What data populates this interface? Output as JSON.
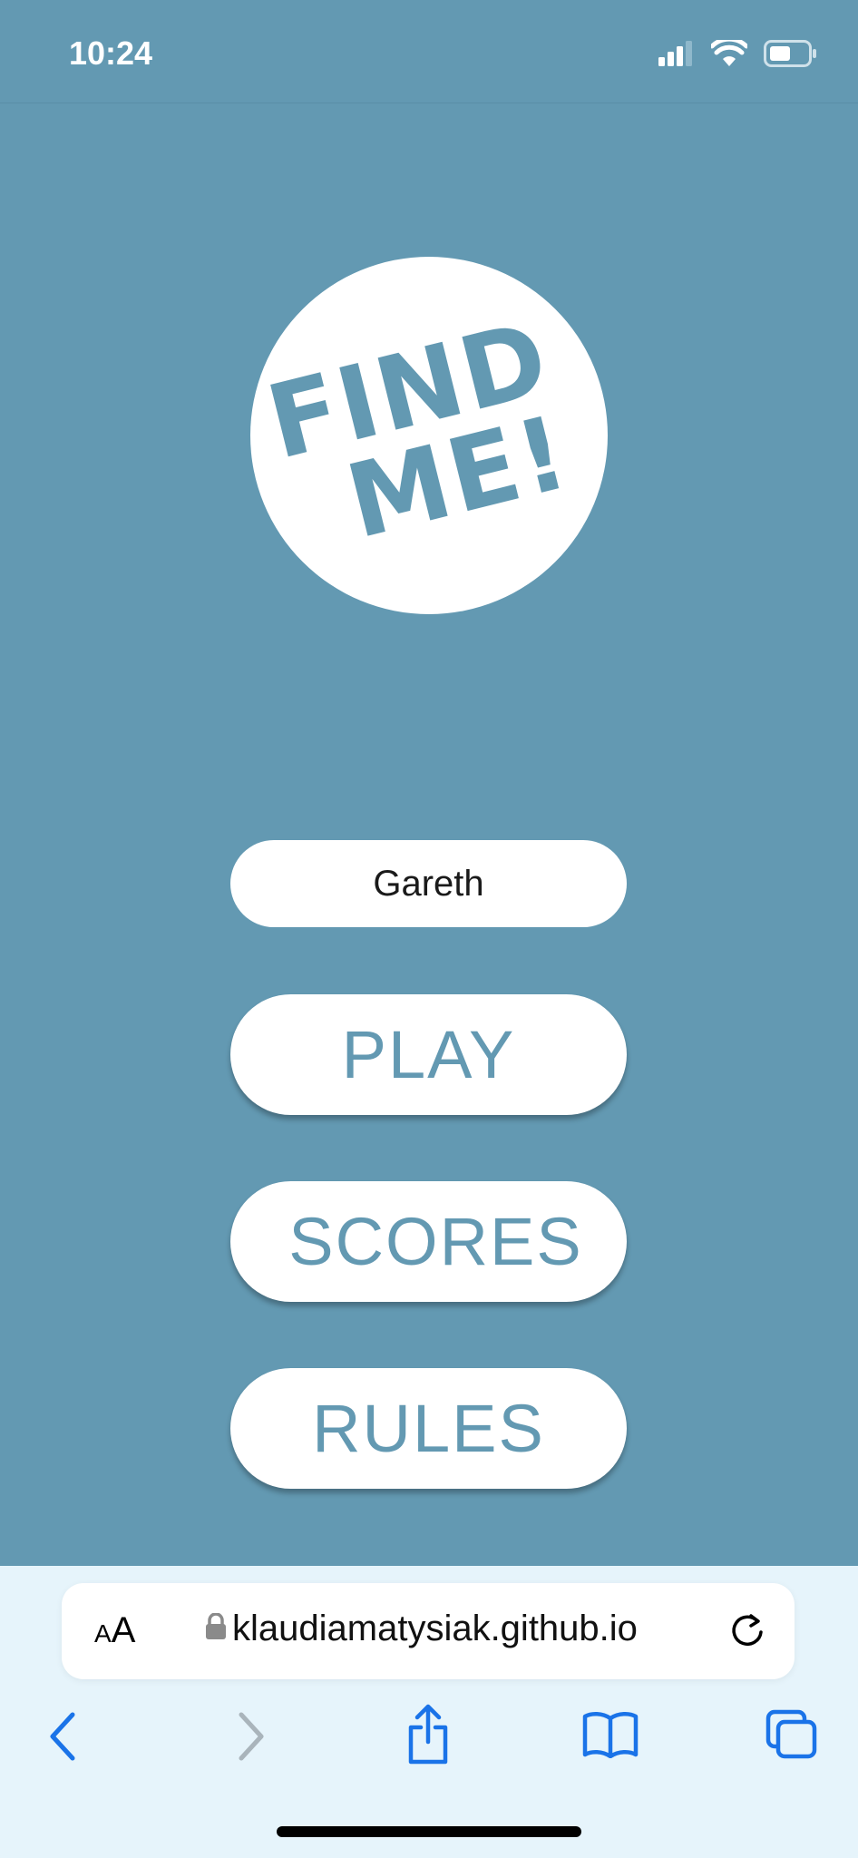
{
  "status_bar": {
    "time": "10:24",
    "icons": [
      "cellular-signal-icon",
      "wifi-icon",
      "battery-icon"
    ]
  },
  "logo": {
    "line1": "FIND",
    "line2": "ME!",
    "background_color": "#ffffff",
    "text_color": "#6399b2"
  },
  "name_input": {
    "value": "Gareth"
  },
  "menu": {
    "play_label": "PLAY",
    "scores_label": "SCORES",
    "rules_label": "RULES"
  },
  "browser": {
    "text_size_small": "A",
    "text_size_big": "A",
    "url": "klaudiamatysiak.github.io",
    "toolbar_icons": [
      "back-icon",
      "forward-icon",
      "share-icon",
      "bookmarks-icon",
      "tabs-icon"
    ]
  },
  "colors": {
    "page_background": "#6399b2",
    "button_background": "#ffffff",
    "accent": "#1a73e8",
    "browser_chrome": "#e6f4fb"
  }
}
